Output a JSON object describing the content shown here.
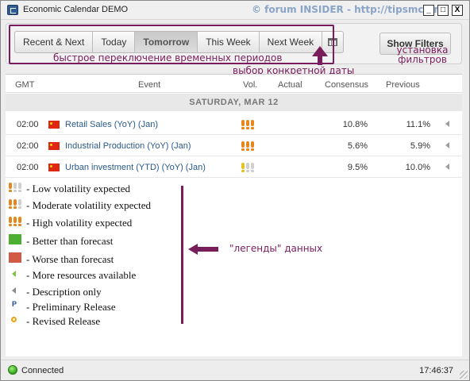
{
  "window": {
    "title": "Economic Calendar DEMO",
    "watermark": "© forum INSIDER - http://tipsmc.org",
    "minimize": "_",
    "maximize": "□",
    "close": "X"
  },
  "toolbar": {
    "tabs": [
      {
        "label": "Recent & Next",
        "active": false
      },
      {
        "label": "Today",
        "active": false
      },
      {
        "label": "Tomorrow",
        "active": true
      },
      {
        "label": "This Week",
        "active": false
      },
      {
        "label": "Next Week",
        "active": false
      }
    ],
    "calendar_icon": "calendar-icon",
    "show_filters": "Show Filters"
  },
  "annotations": {
    "period_switch": "быстрое переключение временных периодов",
    "filters_line1": "установка",
    "filters_line2": "фильтров",
    "date_pick": "выбор конкретной даты",
    "legend": "\"легенды\" данных",
    "accent_color": "#7a1d5c"
  },
  "table": {
    "columns": {
      "gmt": "GMT",
      "event": "Event",
      "vol": "Vol.",
      "actual": "Actual",
      "consensus": "Consensus",
      "previous": "Previous"
    },
    "date_header": "SATURDAY, MAR 12",
    "rows": [
      {
        "time": "02:00",
        "country": "CN",
        "event": "Retail Sales (YoY) (Jan)",
        "volatility": "high",
        "actual": "",
        "consensus": "10.8%",
        "previous": "11.1%"
      },
      {
        "time": "02:00",
        "country": "CN",
        "event": "Industrial Production (YoY) (Jan)",
        "volatility": "high",
        "actual": "",
        "consensus": "5.6%",
        "previous": "5.9%"
      },
      {
        "time": "02:00",
        "country": "CN",
        "event": "Urban investment (YTD) (YoY) (Jan)",
        "volatility": "low",
        "actual": "",
        "consensus": "9.5%",
        "previous": "10.0%"
      }
    ]
  },
  "legend": {
    "items": [
      {
        "icon": "low-volatility-icon",
        "label": "- Low volatility expected"
      },
      {
        "icon": "moderate-volatility-icon",
        "label": "- Moderate volatility expected"
      },
      {
        "icon": "high-volatility-icon",
        "label": "- High volatility expected"
      },
      {
        "icon": "better-square-icon",
        "label": "- Better than forecast",
        "color": "#4caf32"
      },
      {
        "icon": "worse-square-icon",
        "label": "- Worse than forecast",
        "color": "#d05a44"
      },
      {
        "icon": "green-arrow-icon",
        "label": "- More resources available"
      },
      {
        "icon": "gray-arrow-icon",
        "label": "- Description only"
      },
      {
        "icon": "p-letter-icon",
        "label": "- Preliminary Release",
        "glyph": "P"
      },
      {
        "icon": "revised-dot-icon",
        "label": "- Revised Release"
      }
    ]
  },
  "colors": {
    "volatility_orange": "#e8861e",
    "volatility_yellow": "#e8c21e",
    "volatility_inactive": "#cfcfcf",
    "event_link": "#2a5a8a"
  },
  "status": {
    "connection": "Connected",
    "time": "17:46:37"
  }
}
